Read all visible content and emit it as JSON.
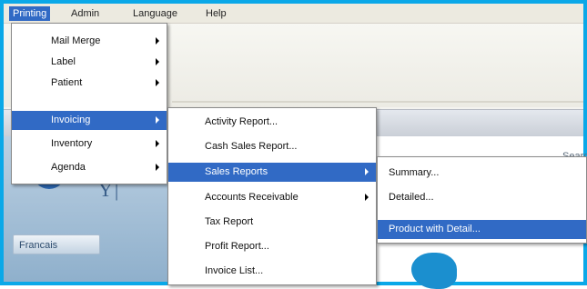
{
  "menubar": {
    "items": [
      {
        "label": "Printing"
      },
      {
        "label": "Admin"
      },
      {
        "label": "Language"
      },
      {
        "label": "Help"
      }
    ]
  },
  "printing_menu": {
    "items": [
      {
        "label": "Mail Merge"
      },
      {
        "label": "Label"
      },
      {
        "label": "Patient"
      },
      {
        "label": "Invoicing"
      },
      {
        "label": "Inventory"
      },
      {
        "label": "Agenda"
      }
    ]
  },
  "invoicing_menu": {
    "items": [
      {
        "label": "Activity Report..."
      },
      {
        "label": "Cash Sales Report..."
      },
      {
        "label": "Sales Reports"
      },
      {
        "label": "Accounts Receivable"
      },
      {
        "label": "Tax Report"
      },
      {
        "label": "Profit Report..."
      },
      {
        "label": "Invoice List..."
      }
    ]
  },
  "sales_reports_menu": {
    "items": [
      {
        "label": "Summary..."
      },
      {
        "label": "Detailed..."
      },
      {
        "label": "Product with Detail..."
      }
    ]
  },
  "left_panel": {
    "language_button": "Francais"
  },
  "content": {
    "search_label": "Searc"
  },
  "colors": {
    "highlight": "#316ac5",
    "frame": "#0aa8e8"
  }
}
